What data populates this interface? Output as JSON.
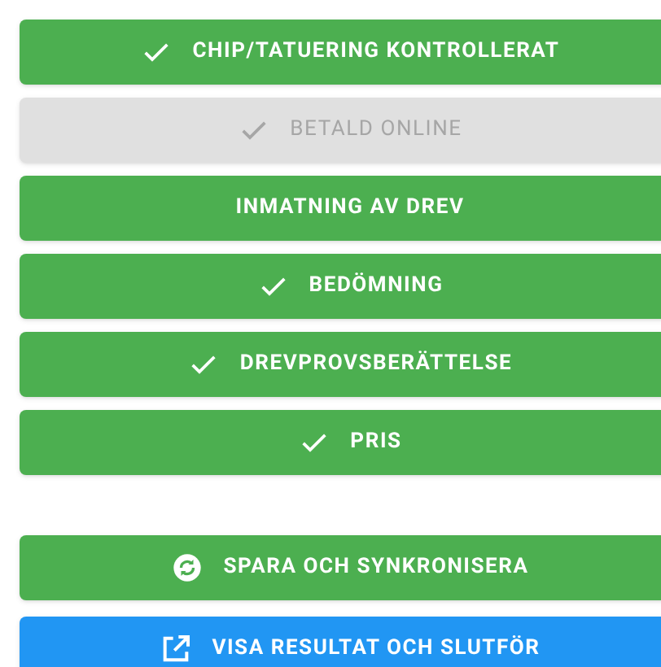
{
  "steps": [
    {
      "label": "CHIP/TATUERING KONTROLLERAT",
      "checked": true,
      "disabled": false
    },
    {
      "label": "BETALD ONLINE",
      "checked": true,
      "disabled": true
    },
    {
      "label": "INMATNING AV DREV",
      "checked": false,
      "disabled": false
    },
    {
      "label": "BEDÖMNING",
      "checked": true,
      "disabled": false
    },
    {
      "label": "DREVPROVSBERÄTTELSE",
      "checked": true,
      "disabled": false
    },
    {
      "label": "PRIS",
      "checked": true,
      "disabled": false
    }
  ],
  "actions": [
    {
      "label": "SPARA OCH SYNKRONISERA",
      "kind": "sync"
    },
    {
      "label": "VISA RESULTAT OCH SLUTFÖR",
      "kind": "open"
    }
  ]
}
